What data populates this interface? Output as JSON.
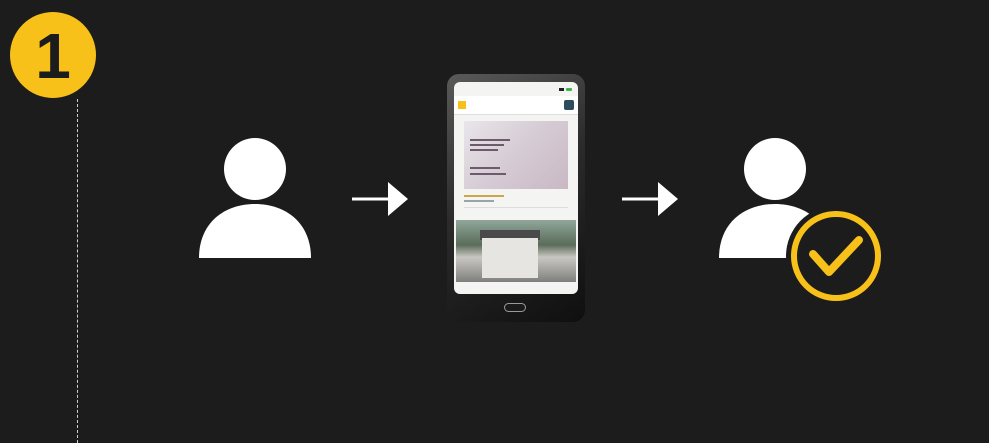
{
  "step": {
    "number": "1"
  },
  "colors": {
    "background": "#1c1c1c",
    "accent": "#f7c11a",
    "icon": "#ffffff",
    "timeline": "#cfcfcf"
  },
  "flow": [
    {
      "name": "user-icon"
    },
    {
      "name": "arrow-right-icon"
    },
    {
      "name": "smartphone-icon"
    },
    {
      "name": "arrow-right-icon"
    },
    {
      "name": "verified-user-icon"
    }
  ]
}
